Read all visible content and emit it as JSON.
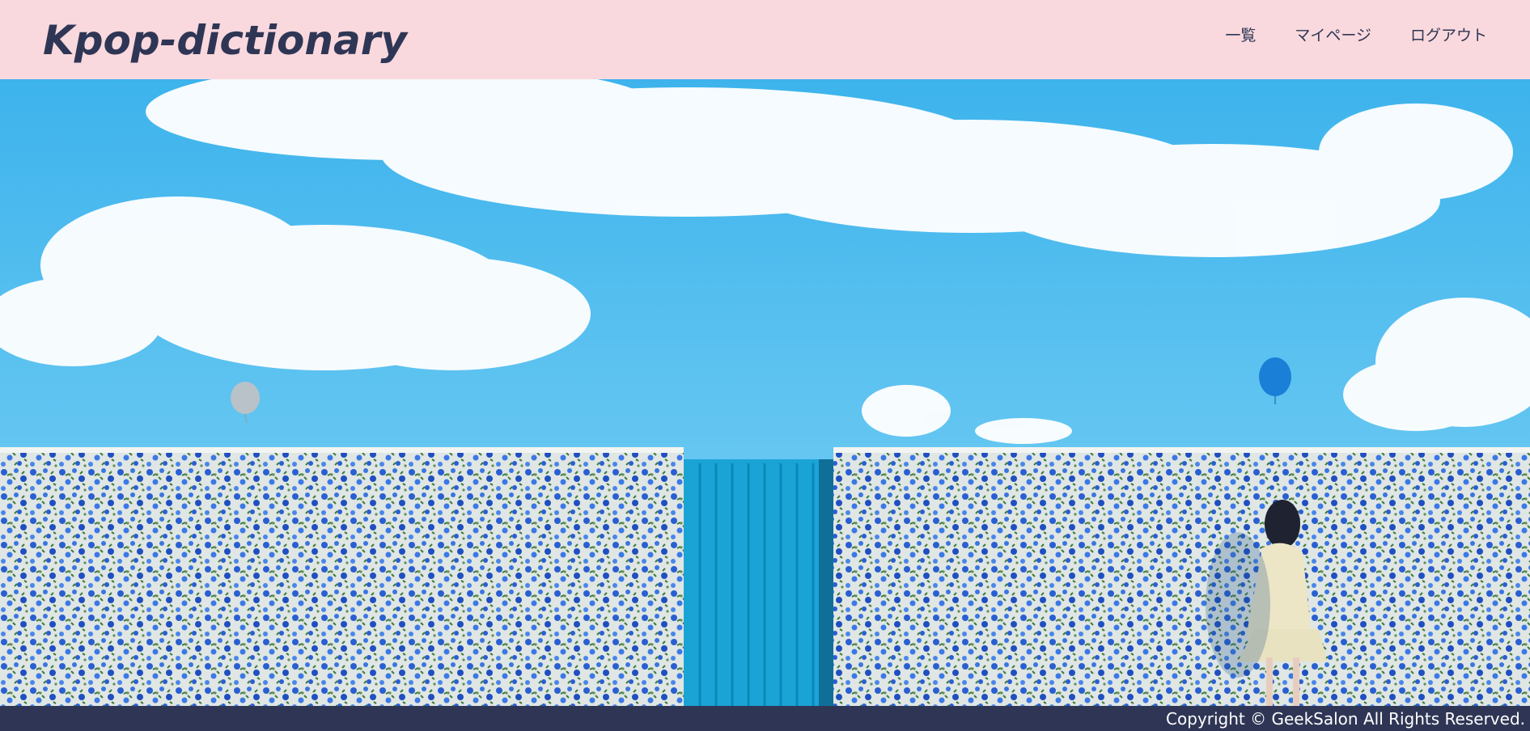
{
  "header": {
    "logo": "Kpop-dictionary",
    "nav": [
      {
        "label": "一覧"
      },
      {
        "label": "マイページ"
      },
      {
        "label": "ログアウト"
      }
    ],
    "background_color": "#f9d9dd",
    "text_color": "#2f3655"
  },
  "hero": {
    "sky_color": "#4ec0ee",
    "gate_color": "#1ea8d8",
    "flower_color": "#2f5fd0"
  },
  "footer": {
    "copyright": "Copyright © GeekSalon All Rights Reserved.",
    "background_color": "#2f3655"
  }
}
